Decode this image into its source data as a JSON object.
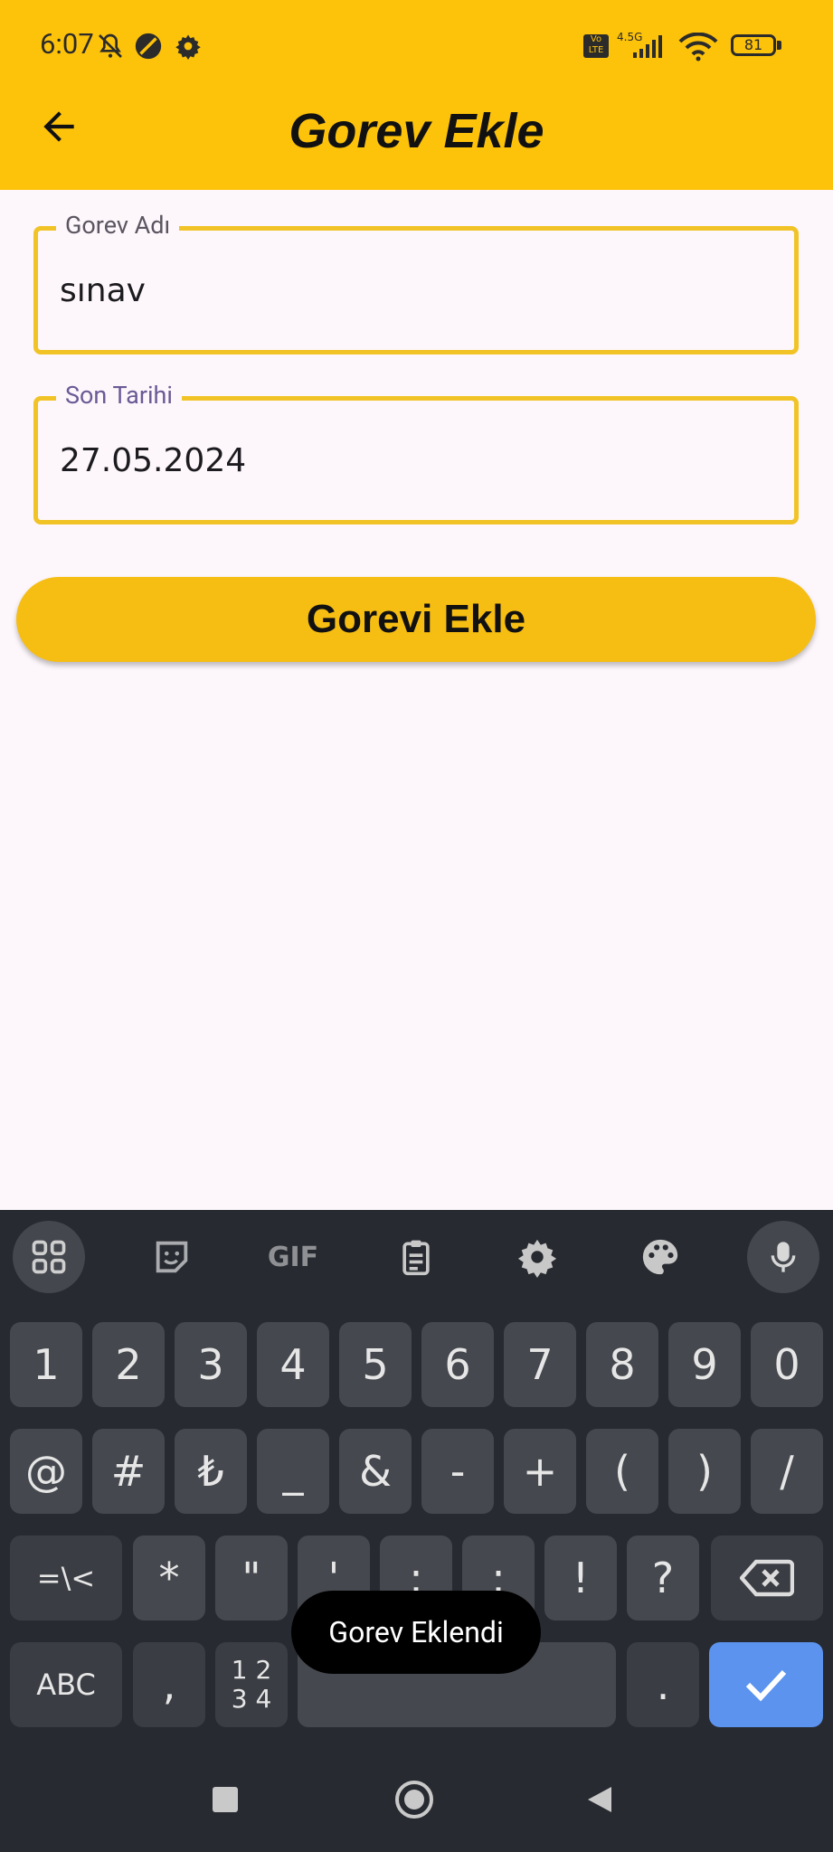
{
  "status_bar": {
    "time": "6:07",
    "network_label": "4.5G",
    "volte_label": "Vo LTE",
    "battery": "81"
  },
  "app_bar": {
    "title": "Gorev Ekle"
  },
  "form": {
    "task_name": {
      "label": "Gorev Adı",
      "value": "sınav"
    },
    "due_date": {
      "label": "Son Tarihi",
      "value": "27.05.2024"
    },
    "submit_label": "Gorevi Ekle"
  },
  "keyboard": {
    "toolbar": [
      "apps-icon",
      "sticker-icon",
      "GIF",
      "clipboard-icon",
      "settings-icon",
      "palette-icon",
      "mic-icon"
    ],
    "row1": [
      "1",
      "2",
      "3",
      "4",
      "5",
      "6",
      "7",
      "8",
      "9",
      "0"
    ],
    "row2": [
      "@",
      "#",
      "₺",
      "_",
      "&",
      "-",
      "+",
      "(",
      ")",
      "/"
    ],
    "row3": [
      "=\\<",
      "*",
      "\"",
      "'",
      ":",
      ";",
      "!",
      "?"
    ],
    "row4": {
      "abc": "ABC",
      "comma": ",",
      "numbers": "1 2\n3 4",
      "period": "."
    }
  },
  "toast": "Gorev Eklendi"
}
